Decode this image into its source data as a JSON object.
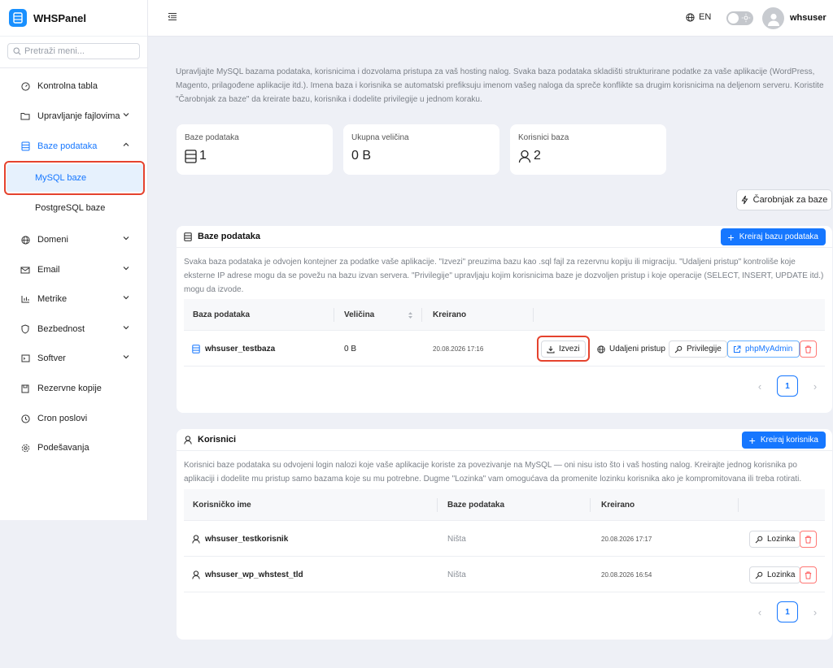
{
  "brand": {
    "name": "WHSPanel"
  },
  "sidebar": {
    "search_placeholder": "Pretraži meni...",
    "items": [
      {
        "label": "Kontrolna tabla",
        "icon": "dashboard-icon"
      },
      {
        "label": "Upravljanje fajlovima",
        "icon": "folder-icon",
        "chevron": "down"
      },
      {
        "label": "Baze podataka",
        "icon": "database-icon",
        "chevron": "up",
        "children": [
          "MySQL baze",
          "PostgreSQL baze"
        ]
      },
      {
        "label": "Domeni",
        "icon": "globe-icon",
        "chevron": "down"
      },
      {
        "label": "Email",
        "icon": "mail-icon",
        "chevron": "down"
      },
      {
        "label": "Metrike",
        "icon": "chart-icon",
        "chevron": "down"
      },
      {
        "label": "Bezbednost",
        "icon": "shield-icon",
        "chevron": "down"
      },
      {
        "label": "Softver",
        "icon": "terminal-icon",
        "chevron": "down"
      },
      {
        "label": "Rezervne kopije",
        "icon": "save-icon"
      },
      {
        "label": "Cron poslovi",
        "icon": "clock-icon"
      },
      {
        "label": "Podešavanja",
        "icon": "gear-icon"
      }
    ]
  },
  "topbar": {
    "language": "EN",
    "username": "whsuser"
  },
  "intro": "Upravljajte MySQL bazama podataka, korisnicima i dozvolama pristupa za vaš hosting nalog. Svaka baza podataka skladišti strukturirane podatke za vaše aplikacije (WordPress, Magento, prilagođene aplikacije itd.). Imena baza i korisnika se automatski prefiksuju imenom vašeg naloga da spreče konflikte sa drugim korisnicima na deljenom serveru. Koristite \"Čarobnjak za baze\" da kreirate bazu, korisnika i dodelite privilegije u jednom koraku.",
  "stats": [
    {
      "label": "Baze podataka",
      "value": "1"
    },
    {
      "label": "Ukupna veličina",
      "value": "0 B"
    },
    {
      "label": "Korisnici baza",
      "value": "2"
    }
  ],
  "wizard_button": "Čarobnjak za baze",
  "databases": {
    "title": "Baze podataka",
    "create_button": "Kreiraj bazu podataka",
    "description": "Svaka baza podataka je odvojen kontejner za podatke vaše aplikacije. \"Izvezi\" preuzima bazu kao .sql fajl za rezervnu kopiju ili migraciju. \"Udaljeni pristup\" kontroliše koje eksterne IP adrese mogu da se povežu na bazu izvan servera. \"Privilegije\" upravljaju kojim korisnicima baze je dozvoljen pristup i koje operacije (SELECT, INSERT, UPDATE itd.) mogu da izvode.",
    "columns": [
      "Baza podataka",
      "Veličina",
      "Kreirano"
    ],
    "rows": [
      {
        "name": "whsuser_testbaza",
        "size": "0 B",
        "created": "20.08.2026 17:16"
      }
    ],
    "actions": {
      "export": "Izvezi",
      "remote": "Udaljeni pristup",
      "privileges": "Privilegije",
      "phpmyadmin": "phpMyAdmin"
    },
    "page": "1"
  },
  "users": {
    "title": "Korisnici",
    "create_button": "Kreiraj korisnika",
    "description": "Korisnici baze podataka su odvojeni login nalozi koje vaše aplikacije koriste za povezivanje na MySQL — oni nisu isto što i vaš hosting nalog. Kreirajte jednog korisnika po aplikaciji i dodelite mu pristup samo bazama koje su mu potrebne. Dugme \"Lozinka\" vam omogućava da promenite lozinku korisnika ako je kompromitovana ili treba rotirati.",
    "columns": [
      "Korisničko ime",
      "Baze podataka",
      "Kreirano"
    ],
    "rows": [
      {
        "name": "whsuser_testkorisnik",
        "databases": "Ništa",
        "created": "20.08.2026 17:17"
      },
      {
        "name": "whsuser_wp_whstest_tld",
        "databases": "Ništa",
        "created": "20.08.2026 16:54"
      }
    ],
    "password_button": "Lozinka",
    "page": "1"
  },
  "colors": {
    "primary": "#1677ff",
    "highlight": "#e5432e",
    "background": "#eef0f6",
    "danger": "#ff4d4f"
  }
}
